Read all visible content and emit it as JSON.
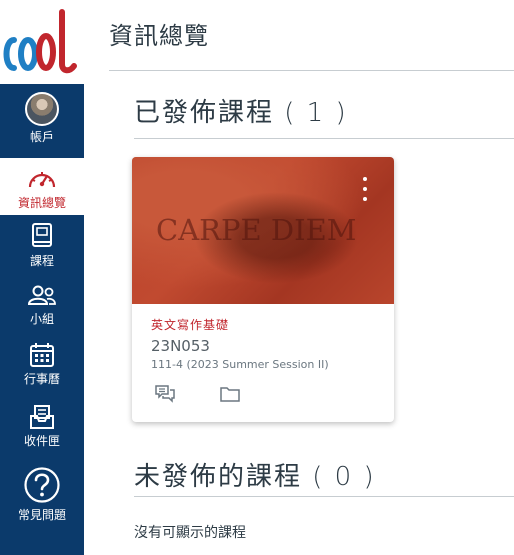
{
  "nav": {
    "logo_text": "cool",
    "account_label": "帳戶",
    "dashboard_label": "資訊總覽",
    "courses_label": "課程",
    "groups_label": "小組",
    "calendar_label": "行事曆",
    "inbox_label": "收件匣",
    "help_label": "常見問題",
    "active_item": "dashboard"
  },
  "page": {
    "title": "資訊總覽"
  },
  "published": {
    "heading": "已發佈課程 ( 1 )"
  },
  "card": {
    "hero_text": "CARPE DIEM",
    "name": "英文寫作基礎",
    "code": "23N053",
    "term": "111-4 (2023 Summer Session II)",
    "hero_color": "#b8412a"
  },
  "unpublished": {
    "heading": "未發佈的課程 ( 0 )",
    "empty_message": "沒有可顯示的課程"
  },
  "colors": {
    "nav_background": "#0b3a6b",
    "accent_red": "#c1262d",
    "text": "#2d3b45"
  },
  "icons": {
    "card_actions": [
      "discussions-icon",
      "files-icon"
    ]
  }
}
